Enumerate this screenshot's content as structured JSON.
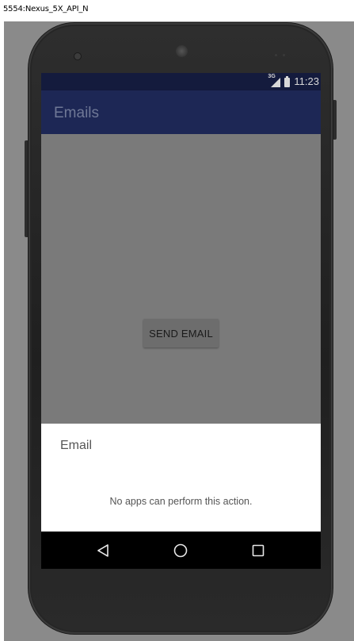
{
  "window": {
    "title": "5554:Nexus_5X_API_N"
  },
  "status_bar": {
    "network": "3G",
    "time": "11:23"
  },
  "app_bar": {
    "title": "Emails"
  },
  "main": {
    "send_button_label": "SEND EMAIL"
  },
  "dialog": {
    "title": "Email",
    "message": "No apps can perform this action."
  },
  "nav_bar": {
    "buttons": [
      "back",
      "home",
      "recents"
    ]
  },
  "colors": {
    "status_bar": "#141b3d",
    "app_bar": "#1d2755",
    "scrim_content": "#7a7a7a",
    "dialog": "#ffffff",
    "nav_bar": "#000000"
  }
}
